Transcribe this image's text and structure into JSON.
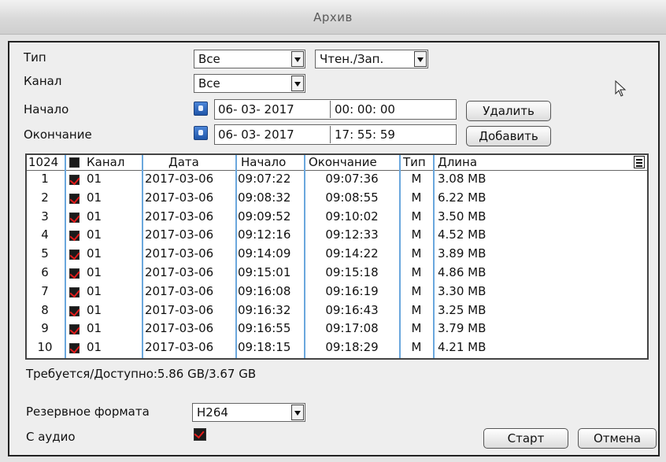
{
  "window": {
    "title": "Архив"
  },
  "filters": {
    "type_label": "Тип",
    "type_value": "Все",
    "mode_value": "Чтен./Зап.",
    "channel_label": "Канал",
    "channel_value": "Все",
    "start_label": "Начало",
    "start_date": "06- 03- 2017",
    "start_time": "00: 00: 00",
    "end_label": "Окончание",
    "end_date": "06- 03- 2017",
    "end_time": "17: 55: 59",
    "delete_label": "Удалить",
    "add_label": "Добавить"
  },
  "table": {
    "headers": {
      "count": "1024",
      "channel": "Канал",
      "date": "Дата",
      "start": "Начало",
      "end": "Окончание",
      "type": "Тип",
      "length": "Длина"
    },
    "rows": [
      {
        "num": "1",
        "checked": true,
        "channel": "01",
        "date": "2017-03-06",
        "start": "09:07:22",
        "end": "09:07:36",
        "type": "M",
        "length": "3.08 MB"
      },
      {
        "num": "2",
        "checked": true,
        "channel": "01",
        "date": "2017-03-06",
        "start": "09:08:32",
        "end": "09:08:55",
        "type": "M",
        "length": "6.22 MB"
      },
      {
        "num": "3",
        "checked": true,
        "channel": "01",
        "date": "2017-03-06",
        "start": "09:09:52",
        "end": "09:10:02",
        "type": "M",
        "length": "3.50 MB"
      },
      {
        "num": "4",
        "checked": true,
        "channel": "01",
        "date": "2017-03-06",
        "start": "09:12:16",
        "end": "09:12:33",
        "type": "M",
        "length": "4.52 MB"
      },
      {
        "num": "5",
        "checked": true,
        "channel": "01",
        "date": "2017-03-06",
        "start": "09:14:09",
        "end": "09:14:22",
        "type": "M",
        "length": "3.89 MB"
      },
      {
        "num": "6",
        "checked": true,
        "channel": "01",
        "date": "2017-03-06",
        "start": "09:15:01",
        "end": "09:15:18",
        "type": "M",
        "length": "4.86 MB"
      },
      {
        "num": "7",
        "checked": true,
        "channel": "01",
        "date": "2017-03-06",
        "start": "09:16:08",
        "end": "09:16:19",
        "type": "M",
        "length": "3.30 MB"
      },
      {
        "num": "8",
        "checked": true,
        "channel": "01",
        "date": "2017-03-06",
        "start": "09:16:32",
        "end": "09:16:43",
        "type": "M",
        "length": "3.25 MB"
      },
      {
        "num": "9",
        "checked": true,
        "channel": "01",
        "date": "2017-03-06",
        "start": "09:16:55",
        "end": "09:17:08",
        "type": "M",
        "length": "3.79 MB"
      },
      {
        "num": "10",
        "checked": true,
        "channel": "01",
        "date": "2017-03-06",
        "start": "09:18:15",
        "end": "09:18:29",
        "type": "M",
        "length": "4.21 MB"
      }
    ]
  },
  "storage_text": "Требуется/Доступно:5.86 GB/3.67 GB",
  "backup": {
    "format_label": "Резервное формата",
    "format_value": "H264",
    "audio_label": "С аудио",
    "audio_checked": true
  },
  "buttons": {
    "start_label": "Старт",
    "cancel_label": "Отмена"
  },
  "icons": {
    "calendar": "calendar-icon",
    "menu": "menu-icon",
    "cursor": "mouse-pointer-icon"
  },
  "colors": {
    "grid_line": "#6aa7dd",
    "check_mark": "#e21b1b"
  }
}
